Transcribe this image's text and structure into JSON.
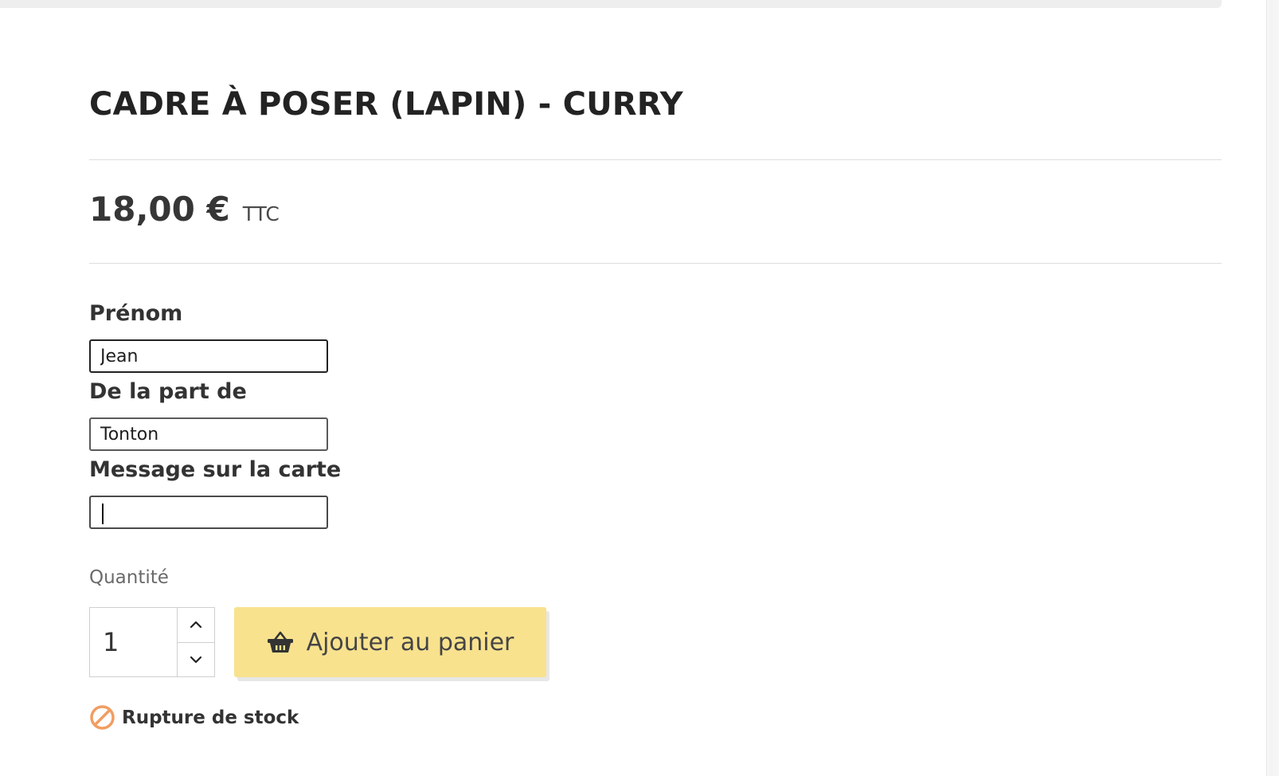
{
  "product": {
    "title": "CADRE À POSER (LAPIN) - CURRY",
    "price": "18,00 €",
    "tax_label": "TTC"
  },
  "customization": {
    "fields": [
      {
        "label": "Prénom",
        "value": "Jean"
      },
      {
        "label": "De la part de",
        "value": "Tonton"
      },
      {
        "label": "Message sur la carte",
        "value": ""
      }
    ]
  },
  "purchase": {
    "quantity_label": "Quantité",
    "quantity": "1",
    "add_to_cart_label": "Ajouter au panier",
    "availability": "Rupture de stock"
  },
  "icons": {
    "add_to_cart": "shopping-basket-icon",
    "availability": "ban-icon",
    "quantity_up": "chevron-up-icon",
    "quantity_down": "chevron-down-icon"
  },
  "colors": {
    "button_background": "#f8e28e",
    "availability_icon": "#f19d62"
  }
}
